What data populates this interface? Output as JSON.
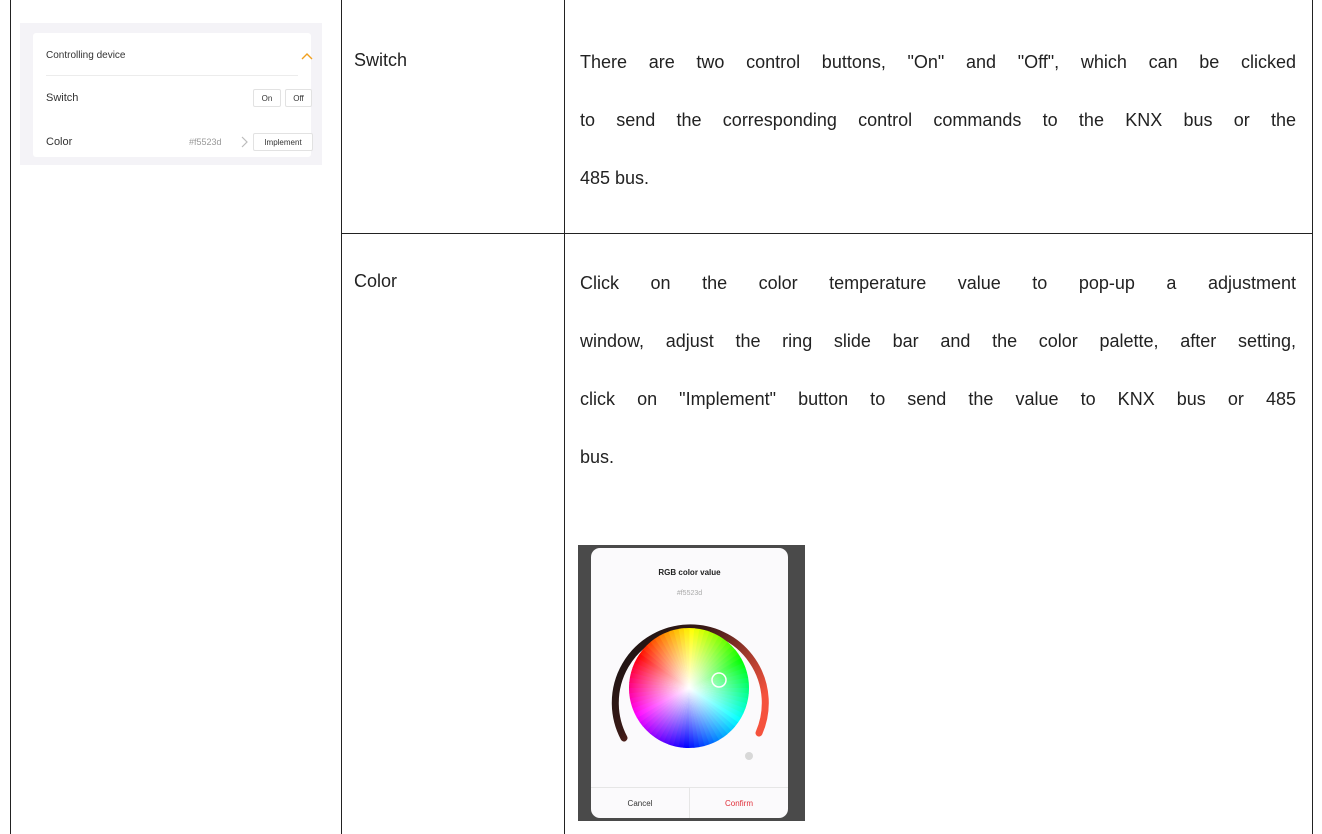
{
  "device_panel": {
    "header": "Controlling device",
    "switch_label": "Switch",
    "on_label": "On",
    "off_label": "Off",
    "color_label": "Color",
    "color_value": "#f5523d",
    "implement_label": "Implement",
    "accent_color": "#f0a020"
  },
  "table": {
    "rows": [
      {
        "name": "Switch",
        "lines": [
          "There are two control buttons, \"On\" and \"Off\", which can be clicked",
          "to send the corresponding control commands to the KNX bus or the",
          "485 bus."
        ]
      },
      {
        "name": "Color",
        "lines": [
          "Click on the color temperature value to pop-up a adjustment",
          "window, adjust the ring slide bar and the color palette, after setting,",
          "click on \"Implement\" button to send the value to KNX bus or 485",
          "bus."
        ]
      }
    ]
  },
  "popup": {
    "title": "RGB color value",
    "hex": "#f5523d",
    "cancel_label": "Cancel",
    "confirm_label": "Confirm",
    "confirm_color": "#e0303a"
  }
}
